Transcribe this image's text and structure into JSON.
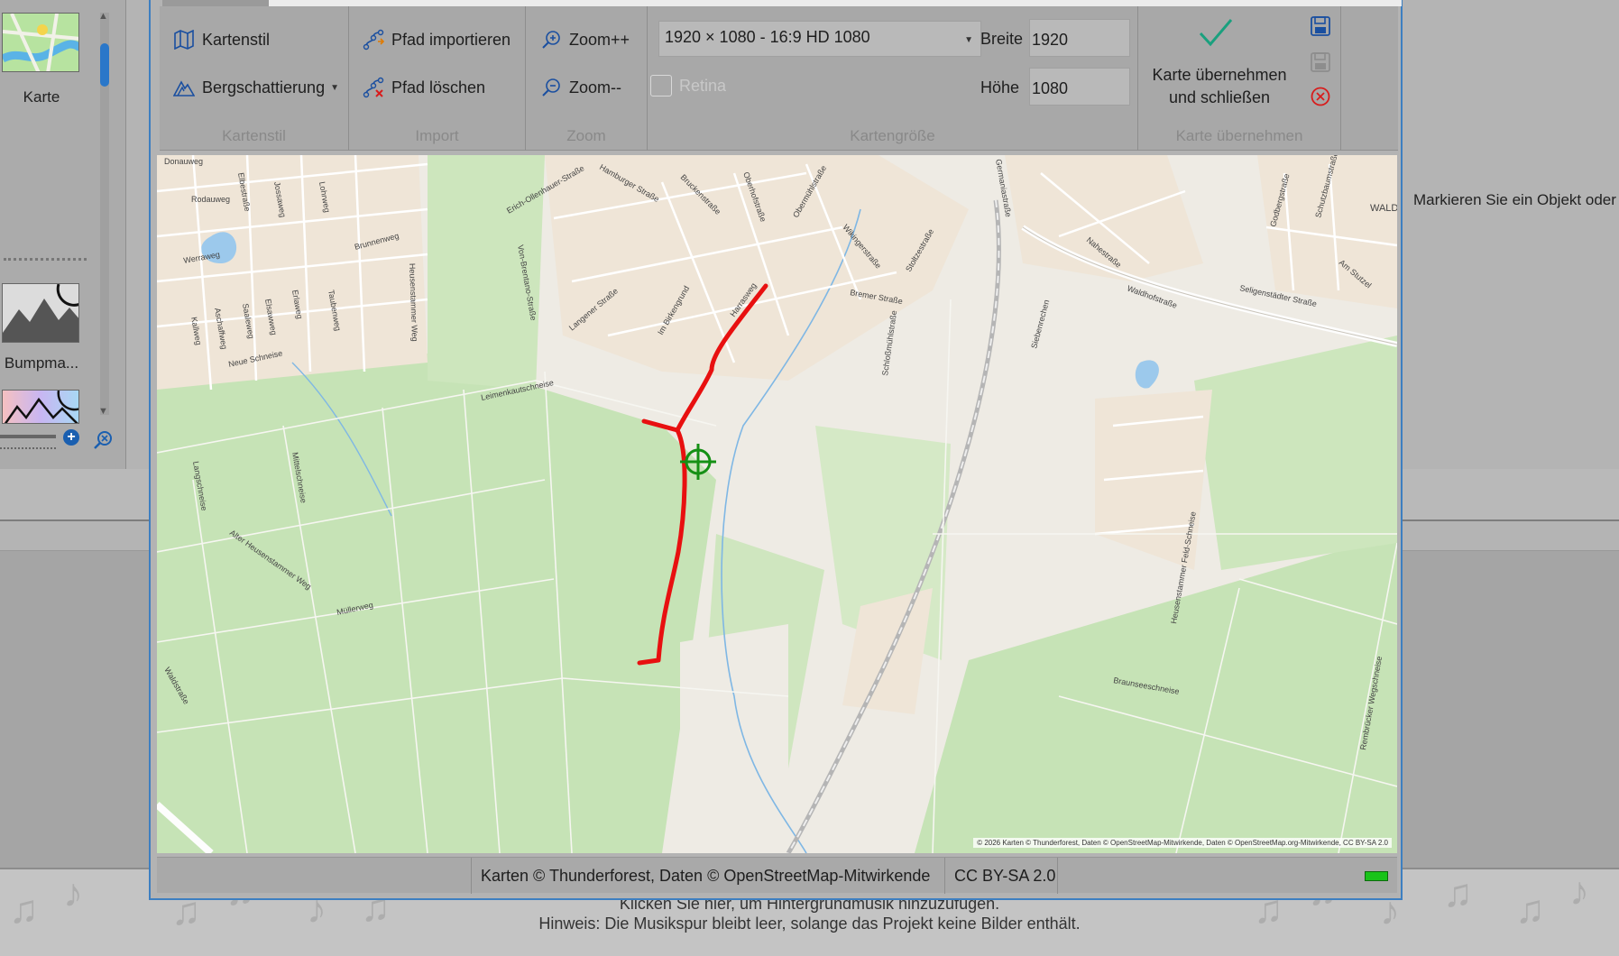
{
  "left_panel": {
    "items": [
      {
        "label": "Karte",
        "icon": "map-thumbnail"
      },
      {
        "label": "Bumpma...",
        "icon": "bumpmap-thumbnail"
      },
      {
        "label": "",
        "icon": "gradient-mountain-thumbnail"
      }
    ]
  },
  "right_panel": {
    "hint": "Markieren Sie ein Objekt oder f"
  },
  "music_track": {
    "line1": "Klicken Sie hier, um Hintergrundmusik hinzuzufügen.",
    "line2": "Hinweis: Die Musikspur bleibt leer, solange das Projekt keine Bilder enthält."
  },
  "ribbon": {
    "kartenstil": {
      "caption": "Kartenstil",
      "style_button": "Kartenstil",
      "hillshade_button": "Bergschattierung"
    },
    "import": {
      "caption": "Import",
      "import_button": "Pfad importieren",
      "delete_button": "Pfad löschen"
    },
    "zoom": {
      "caption": "Zoom",
      "zoom_in": "Zoom++",
      "zoom_out": "Zoom--"
    },
    "kartengroesse": {
      "caption": "Kartengröße",
      "size_select": "1920 × 1080 - 16:9 HD 1080",
      "retina_label": "Retina",
      "retina_checked": false,
      "width_label": "Breite",
      "width_value": "1920",
      "height_label": "Höhe",
      "height_value": "1080"
    },
    "uebernehmen": {
      "caption": "Karte übernehmen",
      "accept_line1": "Karte übernehmen",
      "accept_line2": "und schließen"
    }
  },
  "map": {
    "attribution": "© 2026 Karten © Thunderforest, Daten © OpenStreetMap-Mitwirkende, Daten © OpenStreetMap.org-Mitwirkende, CC BY-SA 2.0",
    "path_color": "#e81010",
    "marker_color": "#159015",
    "labels": [
      "Donauweg",
      "Rodauweg",
      "Elbestraße",
      "Jossaweg",
      "Lohrweg",
      "Werraweg",
      "Brunnenweg",
      "Heusenstammer Weg",
      "Erich-Ollenhauer-Straße",
      "Hamburger Straße",
      "Bruckenstraße",
      "Oberhofstraße",
      "Obermühlstraße",
      "Wikingerstraße",
      "Stoltzestraße",
      "Germaniastraße",
      "Nahestraße",
      "Waldhofstraße",
      "Seligenstädter Straße",
      "Godbergstraße",
      "Schutzbaumstraße",
      "Am Stutzel",
      "WALD",
      "Bremer Straße",
      "Schloßmühlstraße",
      "Siebenrechen",
      "Langener Straße",
      "Im Birkengrund",
      "Harrasweg",
      "Von-Brentano-Straße",
      "Kallweg",
      "Aschaffweg",
      "Saaleweg",
      "Elsawweg",
      "Erlaweg",
      "Taubenweg",
      "Neue Schneise",
      "Leimenkautschneise",
      "Langschneise",
      "Mittelschneise",
      "Alter Heusenstammer Weg",
      "Müllerweg",
      "Waldstraße",
      "Braunseeschneise",
      "Heusenstammer Feld-Schneise",
      "Rembrücker Wegschneise"
    ]
  },
  "statusbar": {
    "source": "Karten © Thunderforest, Daten © OpenStreetMap-Mitwirkende",
    "license": "CC BY-SA 2.0",
    "led_color": "#19c319"
  }
}
